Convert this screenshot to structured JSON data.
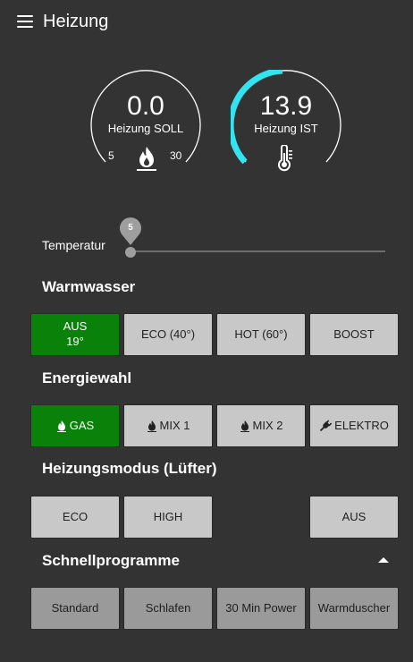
{
  "header": {
    "title": "Heizung",
    "menu_icon": "hamburger-menu-icon"
  },
  "gauges": {
    "soll": {
      "value": "0.0",
      "label": "Heizung SOLL",
      "min": "5",
      "max": "30",
      "icon": "flame-icon",
      "fill_fraction": 0
    },
    "ist": {
      "value": "13.9",
      "label": "Heizung IST",
      "icon": "thermometer-icon",
      "arc_color": "#33e3ee",
      "fill_fraction": 0.35
    }
  },
  "slider": {
    "label": "Temperatur",
    "value": "5"
  },
  "warmwasser": {
    "title": "Warmwasser",
    "buttons": [
      {
        "label": "AUS",
        "sub": "19°",
        "active": true
      },
      {
        "label": "ECO (40°)"
      },
      {
        "label": "HOT (60°)"
      },
      {
        "label": "BOOST"
      }
    ]
  },
  "energiewahl": {
    "title": "Energiewahl",
    "buttons": [
      {
        "label": "GAS",
        "icon": "flame-icon",
        "active": true
      },
      {
        "label": "MIX 1",
        "icon": "flame-icon"
      },
      {
        "label": "MIX 2",
        "icon": "flame-icon"
      },
      {
        "label": "ELEKTRO",
        "icon": "plug-icon"
      }
    ]
  },
  "heizungsmodus": {
    "title": "Heizungsmodus (Lüfter)",
    "buttons": [
      {
        "label": "ECO"
      },
      {
        "label": "HIGH"
      },
      {
        "label": "AUS"
      }
    ]
  },
  "schnellprogramme": {
    "title": "Schnellprogramme",
    "toggle_icon": "chevron-up-icon",
    "buttons": [
      {
        "label": "Standard"
      },
      {
        "label": "Schlafen"
      },
      {
        "label": "30 Min Power"
      },
      {
        "label": "Warmduscher"
      }
    ]
  },
  "colors": {
    "background": "#333333",
    "active": "#0a820a",
    "button": "#c8c8c8",
    "accent_arc": "#33e3ee"
  }
}
